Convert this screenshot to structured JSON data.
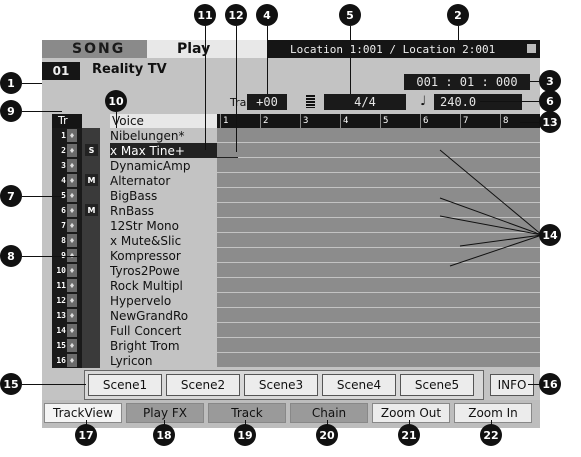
{
  "header": {
    "mode": "SONG",
    "page": "Play",
    "locations": "Location 1:001 / Location 2:001"
  },
  "song": {
    "number": "01",
    "name": "Reality TV"
  },
  "position": "001 : 01 : 000",
  "transpose": {
    "label": "Trans",
    "value": "+00"
  },
  "time_signature": "4/4",
  "tempo": "240.0",
  "columns": {
    "track": "Tr",
    "voice": "Voice"
  },
  "measures": [
    "1",
    "2",
    "3",
    "4",
    "5",
    "6",
    "7",
    "8"
  ],
  "tracks": [
    {
      "num": "1",
      "badge": "",
      "name": "Nibelungen*"
    },
    {
      "num": "2",
      "badge": "S",
      "name": "x Max Tine+"
    },
    {
      "num": "3",
      "badge": "",
      "name": "DynamicAmp"
    },
    {
      "num": "4",
      "badge": "M",
      "name": "Alternator"
    },
    {
      "num": "5",
      "badge": "",
      "name": "BigBass"
    },
    {
      "num": "6",
      "badge": "M",
      "name": "RnBass"
    },
    {
      "num": "7",
      "badge": "",
      "name": "12Str Mono"
    },
    {
      "num": "8",
      "badge": "",
      "name": "x Mute&Slic"
    },
    {
      "num": "9",
      "badge": "",
      "name": "Kompressor"
    },
    {
      "num": "10",
      "badge": "",
      "name": "Tyros2Powe"
    },
    {
      "num": "11",
      "badge": "",
      "name": "Rock Multipl"
    },
    {
      "num": "12",
      "badge": "",
      "name": "Hypervelo"
    },
    {
      "num": "13",
      "badge": "",
      "name": "NewGrandRo"
    },
    {
      "num": "14",
      "badge": "",
      "name": "Full Concert"
    },
    {
      "num": "15",
      "badge": "",
      "name": "Bright Trom"
    },
    {
      "num": "16",
      "badge": "",
      "name": "Lyricon"
    }
  ],
  "scenes": [
    "Scene1",
    "Scene2",
    "Scene3",
    "Scene4",
    "Scene5"
  ],
  "info_label": "INFO",
  "tabs": [
    "TrackView",
    "Play FX",
    "Track",
    "Chain",
    "Zoom Out",
    "Zoom In"
  ],
  "callouts": [
    "1",
    "2",
    "3",
    "4",
    "5",
    "6",
    "7",
    "8",
    "9",
    "10",
    "11",
    "12",
    "13",
    "14",
    "15",
    "16",
    "17",
    "18",
    "19",
    "20",
    "21",
    "22"
  ]
}
